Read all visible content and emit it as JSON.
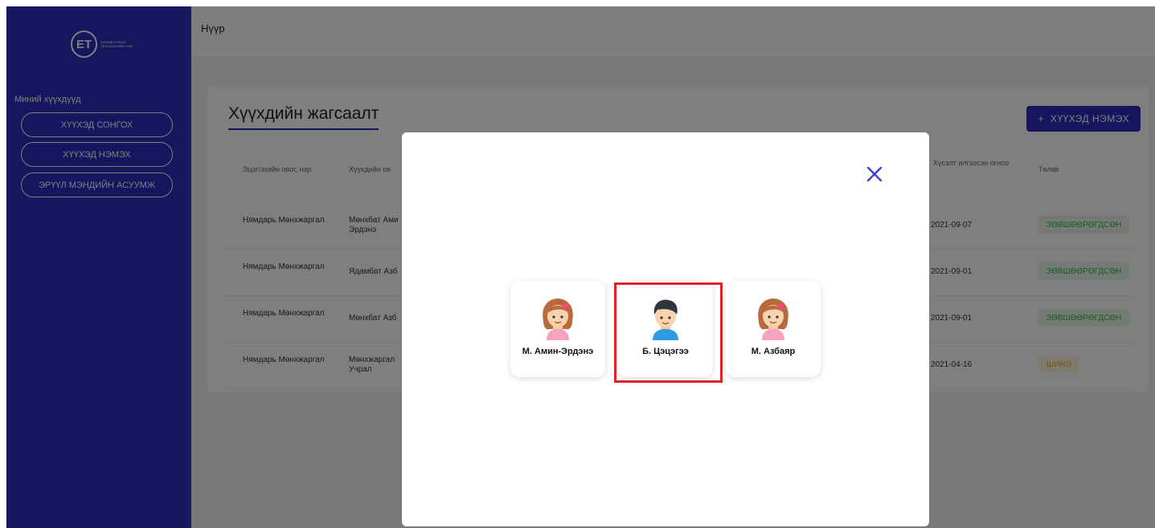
{
  "app": {
    "logo_text": "ЕТ",
    "logo_sub": "БОЛОВСРОЛЫН ТЕХНОЛОГИЙН ТӨВ"
  },
  "sidebar": {
    "section_title": "Миний хүүхдүүд",
    "items": [
      {
        "label": "ХҮҮХЭД СОНГОХ"
      },
      {
        "label": "ХҮҮХЭД НЭМЭХ"
      },
      {
        "label": "ЭРҮҮЛ МЭНДИЙН АСУУМЖ"
      }
    ]
  },
  "topbar": {
    "title": "Нүүр"
  },
  "page": {
    "title": "Хүүхдийн жагсаалт",
    "add_button": "ХҮҮХЭД НЭМЭХ",
    "columns": {
      "parent": "Эцэг/эхийн овог, нэр",
      "child": "Хүүхдийн ов",
      "request_date": "Хүсэлт илгээсэн огноо",
      "status": "Төлөв"
    },
    "rows": [
      {
        "parent": "Нямдарь Мөнхжаргал",
        "child": "Мөнхбат Ами Эрдэнэ",
        "date": "2021-09-07",
        "status": "ЗӨВШӨӨРӨГДСӨН",
        "status_color": "#35b54a"
      },
      {
        "parent": "Нямдарь Мөнхжаргал",
        "child": "Ядамбат Азб",
        "date": "2021-09-01",
        "status": "ЗӨВШӨӨРӨГДСӨН",
        "status_color": "#35b54a"
      },
      {
        "parent": "Нямдарь Мөнхжаргал",
        "child": "Мөнхбат Азб",
        "date": "2021-09-01",
        "status": "ЗӨВШӨӨРӨГДСӨН",
        "status_color": "#35b54a"
      },
      {
        "parent": "Нямдарь Мөнхжаргал",
        "child": "Мөнхжаргал Учрал",
        "date": "2021-04-16",
        "status": "ШИНЭ",
        "status_color": "#f0a020"
      }
    ]
  },
  "modal": {
    "children": [
      {
        "name": "М. Амин-Эрдэнэ",
        "avatar": "girl-avatar-icon"
      },
      {
        "name": "Б. Цэцэгээ",
        "avatar": "boy-avatar-icon"
      },
      {
        "name": "М. Азбаяр",
        "avatar": "girl-avatar-icon"
      }
    ],
    "close_icon": "close-icon",
    "highlight_color": "#e0202a"
  }
}
